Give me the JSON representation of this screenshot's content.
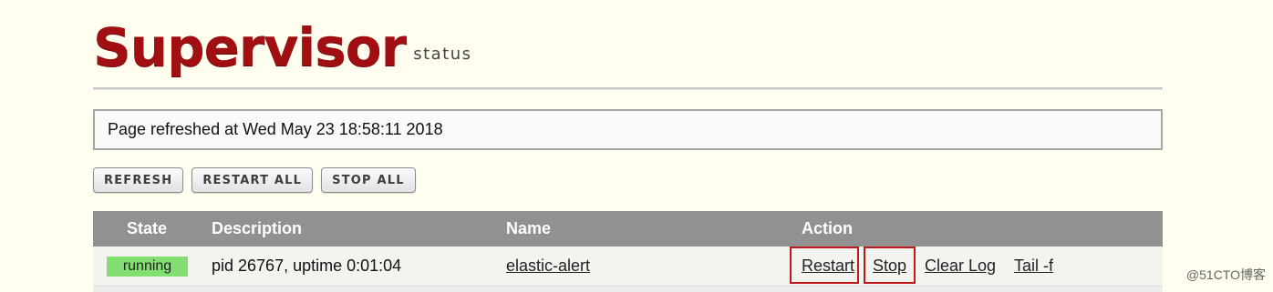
{
  "brand": {
    "title": "Supervisor",
    "subtitle": "status"
  },
  "status_message": "Page refreshed at Wed May 23 18:58:11 2018",
  "buttons": {
    "refresh": "REFRESH",
    "restart_all": "RESTART ALL",
    "stop_all": "STOP ALL"
  },
  "table": {
    "headers": {
      "state": "State",
      "description": "Description",
      "name": "Name",
      "action": "Action"
    },
    "rows": [
      {
        "state": "running",
        "description": "pid 26767, uptime 0:01:04",
        "name": "elastic-alert",
        "actions": {
          "restart": "Restart",
          "stop": "Stop",
          "clear_log": "Clear Log",
          "tail": "Tail -f"
        }
      }
    ]
  },
  "watermark": "@51CTO博客",
  "colors": {
    "background": "#fffeef",
    "brand_red": "#a10f12",
    "header_gray": "#919191",
    "running_green": "#83df71",
    "highlight_red": "#c01818"
  }
}
